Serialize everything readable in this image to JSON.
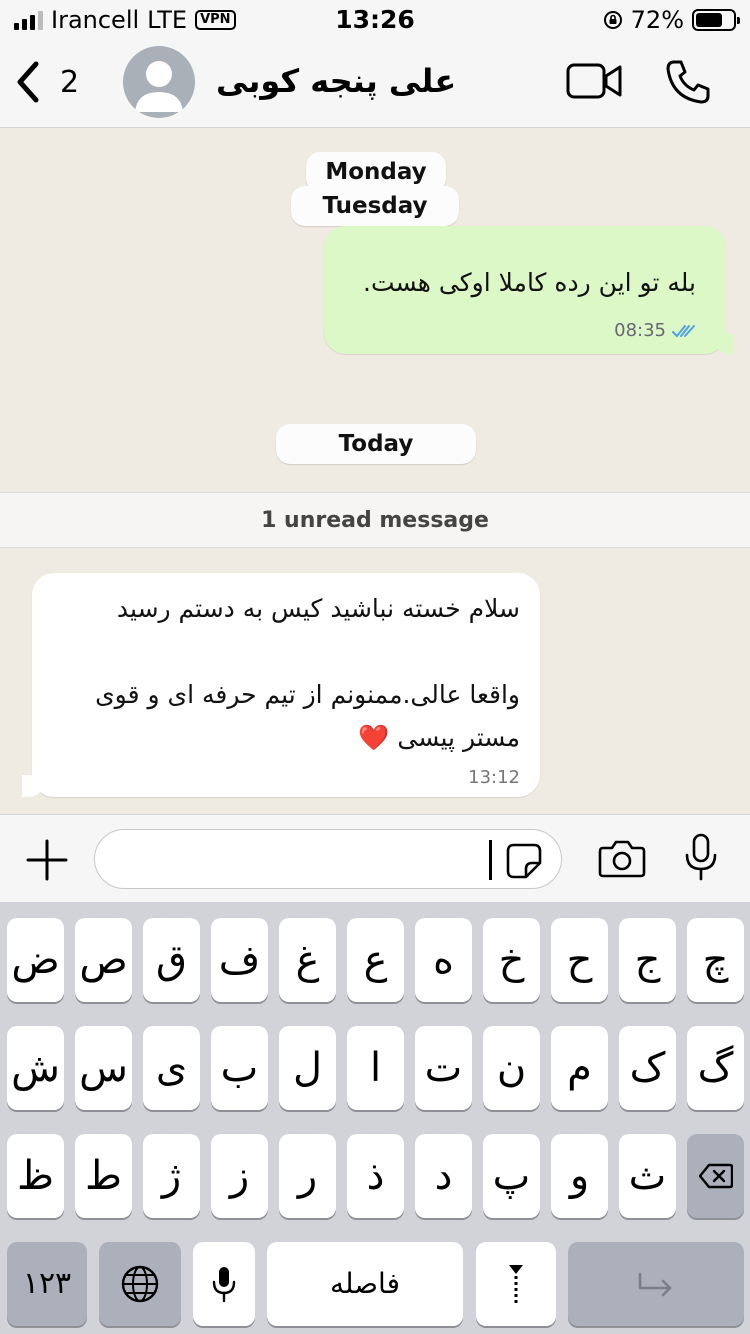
{
  "status_bar": {
    "carrier": "Irancell",
    "network": "LTE",
    "vpn": "VPN",
    "time": "13:26",
    "battery_percent": "72%",
    "battery_level": 0.72
  },
  "header": {
    "back_count": "2",
    "contact_name": "علی پنجه کوبی"
  },
  "chat": {
    "date_labels": [
      "Monday",
      "Tuesday",
      "Today"
    ],
    "outgoing_message": {
      "text": "بله تو این رده کاملا اوکی هست.",
      "time": "08:35"
    },
    "unread_label": "1 unread message",
    "incoming_message": {
      "text": "سلام خسته نباشید کیس به دستم رسید\n\nواقعا عالی.ممنونم از تیم حرفه ای و قوی\nمستر پیسی ❤️",
      "time": "13:12"
    }
  },
  "input": {
    "value": "",
    "placeholder": ""
  },
  "keyboard": {
    "row1": [
      "چ",
      "ج",
      "ح",
      "خ",
      "ه",
      "ع",
      "غ",
      "ف",
      "ق",
      "ص",
      "ض"
    ],
    "row2": [
      "گ",
      "ک",
      "م",
      "ن",
      "ت",
      "ا",
      "ل",
      "ب",
      "ی",
      "س",
      "ش"
    ],
    "row3": [
      "ث",
      "و",
      "پ",
      "د",
      "ذ",
      "ر",
      "ز",
      "ژ",
      "ط",
      "ظ"
    ],
    "numbers_key": "۱۲۳",
    "space_key": "فاصله",
    "icons": {
      "delete": "backspace-icon",
      "globe": "globe-icon",
      "mic": "microphone-icon",
      "zwnj": "zwnj-icon",
      "return": "return-icon"
    }
  },
  "colors": {
    "chat_bg": "#efeae2",
    "outgoing_bubble": "#dcf8c6",
    "incoming_bubble": "#ffffff",
    "read_ticks": "#4fa0e6",
    "keyboard_bg": "#d1d3d9"
  }
}
